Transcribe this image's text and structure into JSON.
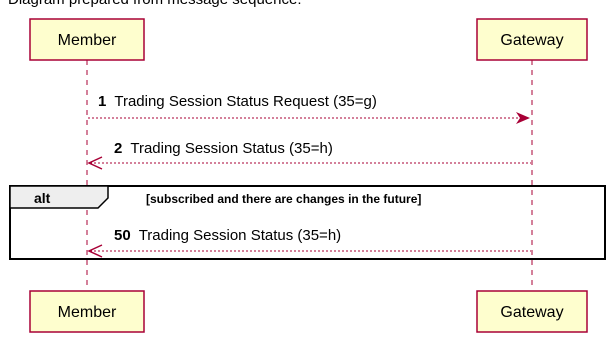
{
  "header_text": "Diagram prepared from message sequence:",
  "participants": {
    "member": {
      "label": "Member"
    },
    "gateway": {
      "label": "Gateway"
    }
  },
  "messages": [
    {
      "number": "1",
      "text": "Trading Session Status Request (35=g)",
      "direction": "member-to-gateway",
      "style": "dashed"
    },
    {
      "number": "2",
      "text": "Trading Session Status (35=h)",
      "direction": "gateway-to-member",
      "style": "dashed"
    },
    {
      "number": "50",
      "text": "Trading Session Status (35=h)",
      "direction": "gateway-to-member",
      "style": "dashed"
    }
  ],
  "fragment": {
    "operator": "alt",
    "guard": "[subscribed and there are changes in the future]"
  },
  "colors": {
    "participant_fill": "#FEFECE",
    "participant_border": "#A80036",
    "arrow": "#A80036",
    "lifeline": "#A80036",
    "fragment_header_fill": "#EEEEEE"
  }
}
